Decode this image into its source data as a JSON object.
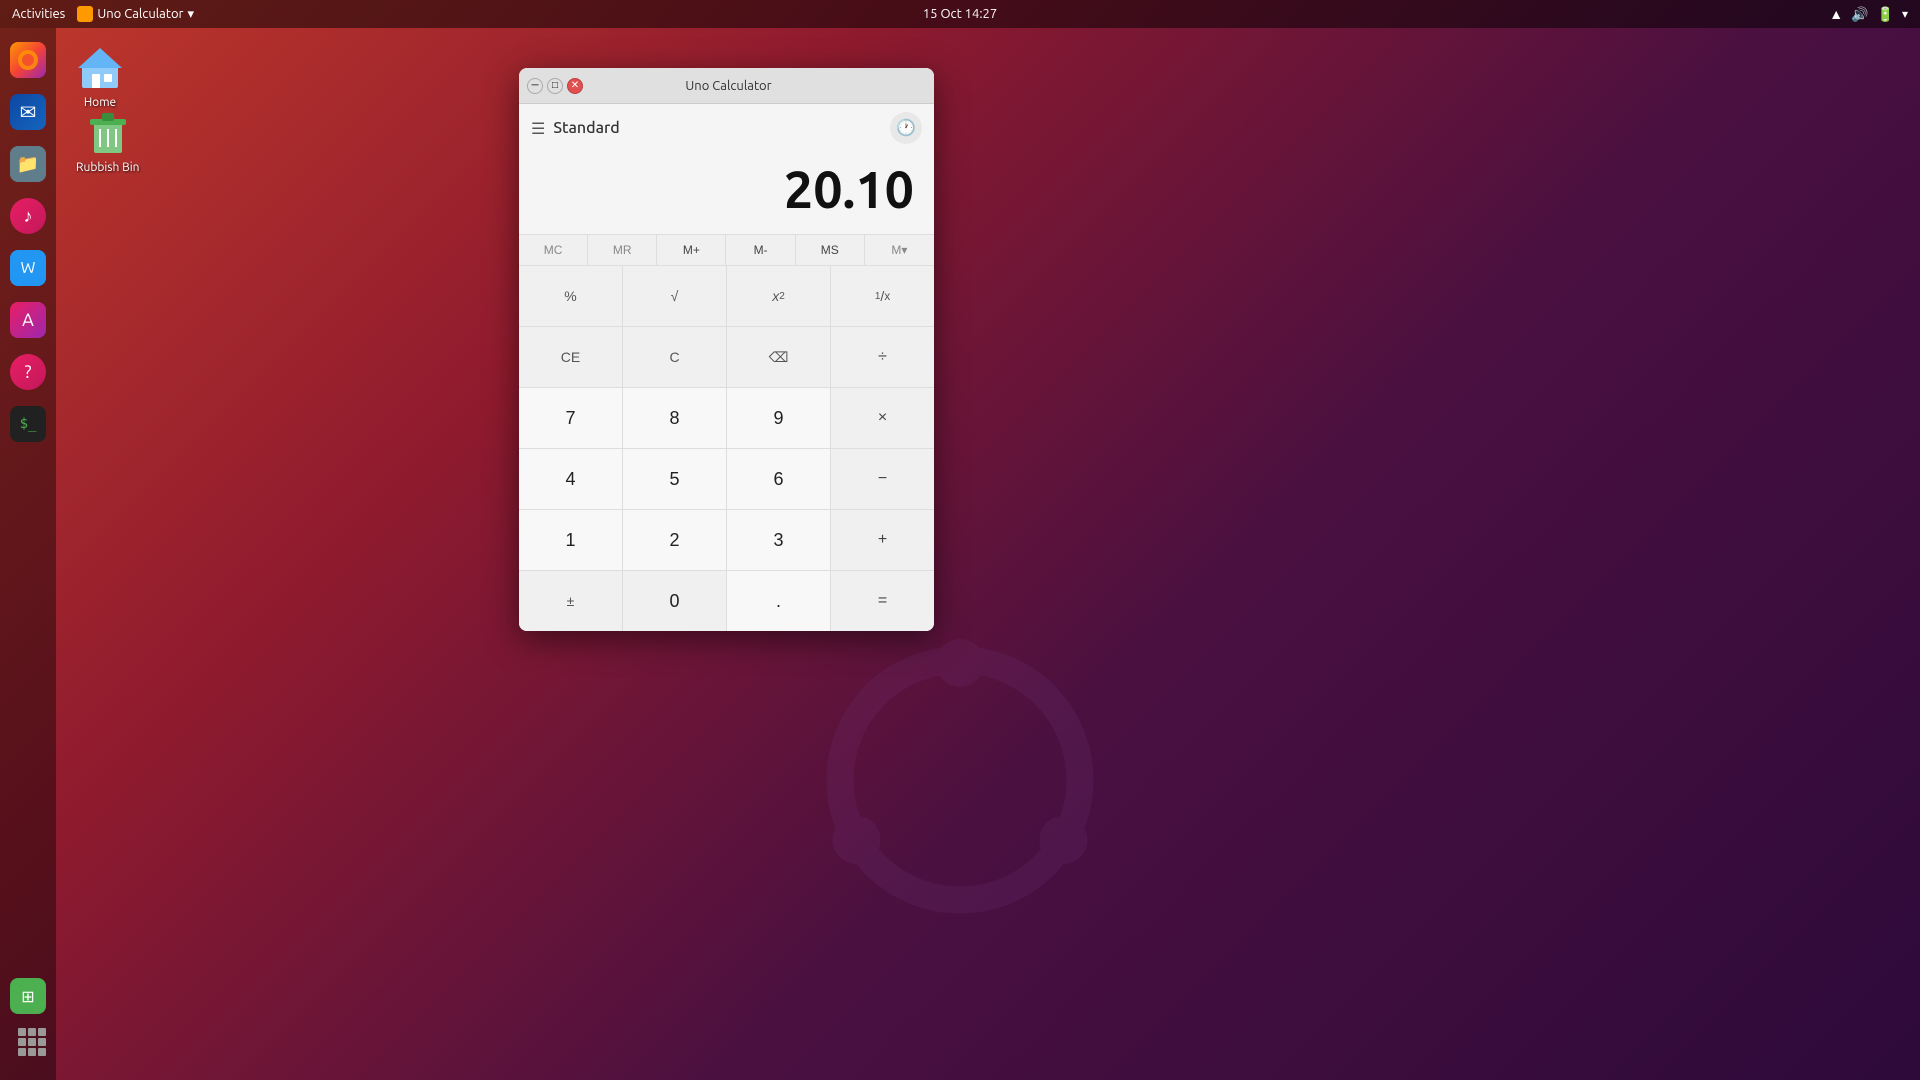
{
  "topbar": {
    "activities": "Activities",
    "app_name": "Uno Calculator",
    "app_arrow": "▾",
    "datetime": "15 Oct  14:27",
    "tray_icons": [
      "wifi",
      "volume",
      "battery",
      "settings"
    ]
  },
  "desktop": {
    "icons": [
      {
        "id": "home",
        "label": "Home",
        "icon": "home"
      },
      {
        "id": "rubbish-bin",
        "label": "Rubbish Bin",
        "icon": "trash"
      }
    ]
  },
  "dock": {
    "items": [
      {
        "id": "firefox",
        "label": "Firefox"
      },
      {
        "id": "thunderbird",
        "label": "Thunderbird"
      },
      {
        "id": "files",
        "label": "Files"
      },
      {
        "id": "rhythmbox",
        "label": "Rhythmbox"
      },
      {
        "id": "libreoffice-writer",
        "label": "LibreOffice Writer"
      },
      {
        "id": "app-store",
        "label": "App Store"
      },
      {
        "id": "help",
        "label": "Help"
      },
      {
        "id": "terminal",
        "label": "Terminal"
      },
      {
        "id": "libreoffice-calc",
        "label": "LibreOffice Calc"
      }
    ]
  },
  "calculator": {
    "title": "Uno Calculator",
    "mode": "Standard",
    "display": "20.10",
    "history_btn_label": "🕐",
    "memory_buttons": [
      {
        "id": "mc",
        "label": "MC",
        "active": false
      },
      {
        "id": "mr",
        "label": "MR",
        "active": false
      },
      {
        "id": "mplus",
        "label": "M+",
        "active": true
      },
      {
        "id": "mminus",
        "label": "M-",
        "active": true
      },
      {
        "id": "ms",
        "label": "MS",
        "active": true
      },
      {
        "id": "mmenu",
        "label": "M▾",
        "active": false
      }
    ],
    "buttons": [
      {
        "id": "percent",
        "label": "%",
        "type": "special"
      },
      {
        "id": "sqrt",
        "label": "√",
        "type": "special"
      },
      {
        "id": "square",
        "label": "x²",
        "type": "special",
        "sup": "2"
      },
      {
        "id": "inverse",
        "label": "¹⁄ₓ",
        "type": "special"
      },
      {
        "id": "ce",
        "label": "CE",
        "type": "special"
      },
      {
        "id": "c",
        "label": "C",
        "type": "special"
      },
      {
        "id": "backspace",
        "label": "⌫",
        "type": "special"
      },
      {
        "id": "divide",
        "label": "÷",
        "type": "operator"
      },
      {
        "id": "seven",
        "label": "7",
        "type": "number"
      },
      {
        "id": "eight",
        "label": "8",
        "type": "number"
      },
      {
        "id": "nine",
        "label": "9",
        "type": "number"
      },
      {
        "id": "multiply",
        "label": "×",
        "type": "operator"
      },
      {
        "id": "four",
        "label": "4",
        "type": "number"
      },
      {
        "id": "five",
        "label": "5",
        "type": "number"
      },
      {
        "id": "six",
        "label": "6",
        "type": "number"
      },
      {
        "id": "subtract",
        "label": "−",
        "type": "operator"
      },
      {
        "id": "one",
        "label": "1",
        "type": "number"
      },
      {
        "id": "two",
        "label": "2",
        "type": "number"
      },
      {
        "id": "three",
        "label": "3",
        "type": "number"
      },
      {
        "id": "add",
        "label": "+",
        "type": "operator"
      },
      {
        "id": "plusminus",
        "label": "±",
        "type": "special"
      },
      {
        "id": "zero",
        "label": "0",
        "type": "number"
      },
      {
        "id": "decimal",
        "label": ".",
        "type": "number"
      },
      {
        "id": "equals",
        "label": "=",
        "type": "operator"
      }
    ]
  }
}
